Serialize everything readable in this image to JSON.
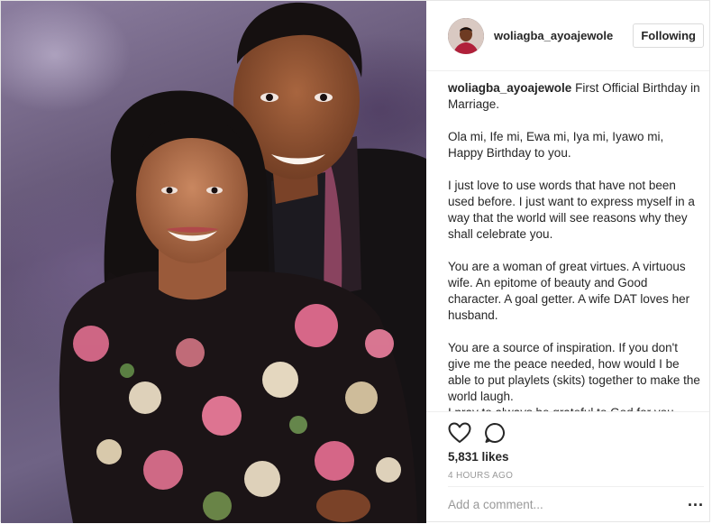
{
  "post": {
    "username": "woliagba_ayoajewole",
    "follow_label": "Following",
    "caption_username": "woliagba_ayoajewole",
    "caption_paragraphs": [
      "First Official Birthday in Marriage.",
      "Ola mi, Ife mi, Ewa mi, Iya mi, Iyawo mi, Happy Birthday to you.",
      "I just love to use words that have not been used before. I just want to express myself in a way that the world will see reasons why they shall celebrate you.",
      "You are a woman of great virtues. A virtuous wife. An epitome of beauty and Good character. A goal getter. A wife DAT loves her husband.",
      "You are a source of inspiration. If you don't give me the peace needed, how would I be able to put playlets (skits) together to make the world laugh.",
      "I pray to always be grateful to God for you. God bless you for me."
    ],
    "likes": "5,831 likes",
    "time": "4 HOURS AGO",
    "comment_placeholder": "Add a comment...",
    "more_label": "..."
  },
  "icons": {
    "like": "heart-icon",
    "comment": "comment-icon",
    "more": "more-options-icon"
  },
  "colors": {
    "text": "#262626",
    "muted": "#999999",
    "border": "#efefef",
    "button_border": "#dbdbdb"
  }
}
